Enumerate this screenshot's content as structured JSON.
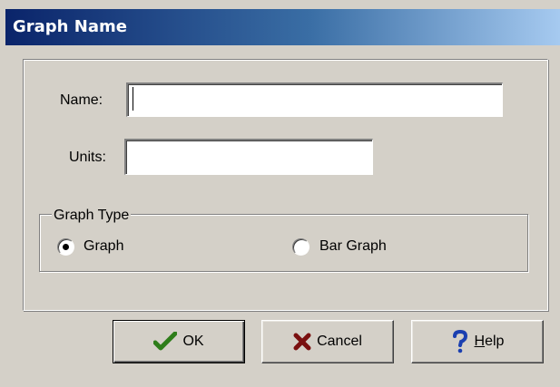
{
  "window": {
    "title": "Graph Name"
  },
  "form": {
    "name_label": "Name:",
    "name_value": "",
    "units_label": "Units:",
    "units_value": ""
  },
  "graph_type": {
    "legend": "Graph Type",
    "options": [
      {
        "label": "Graph",
        "selected": true
      },
      {
        "label": "Bar Graph",
        "selected": false
      }
    ]
  },
  "buttons": {
    "ok": {
      "label": "OK",
      "icon": "checkmark-icon",
      "color": "#2e7d1a"
    },
    "cancel": {
      "label": "Cancel",
      "icon": "x-icon",
      "color": "#7a1010"
    },
    "help": {
      "label_prefix": "",
      "label_underlined": "H",
      "label_rest": "elp",
      "icon": "question-mark-icon",
      "color": "#1a3fb0"
    }
  }
}
